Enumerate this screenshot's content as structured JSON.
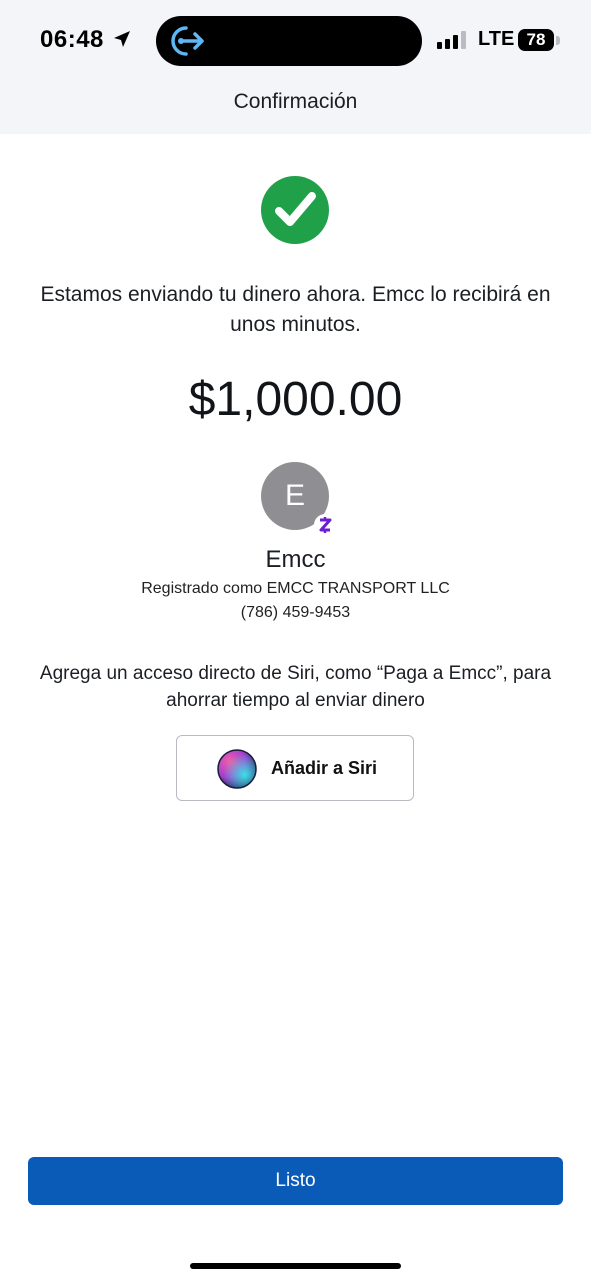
{
  "status_bar": {
    "time": "06:48",
    "network": "LTE",
    "battery": "78",
    "icons": [
      "location-arrow-icon",
      "session-share-icon",
      "signal-icon",
      "battery-icon"
    ]
  },
  "header": {
    "title": "Confirmación"
  },
  "confirmation": {
    "icon": "checkmark-icon",
    "message": "Estamos enviando tu dinero ahora. Emcc lo recibirá en unos minutos.",
    "amount": "$1,000.00"
  },
  "recipient": {
    "initial": "E",
    "name": "Emcc",
    "registered_as": "Registrado como EMCC TRANSPORT LLC",
    "phone": "(786) 459-9453",
    "badge_icon": "zelle-icon"
  },
  "siri": {
    "hint": "Agrega un acceso directo de Siri, como “Paga a Emcc”, para ahorrar tiempo al enviar dinero",
    "button_label": "Añadir a Siri",
    "icon": "siri-icon"
  },
  "footer": {
    "done_label": "Listo"
  },
  "colors": {
    "success": "#21a04a",
    "primary": "#0a5bb8",
    "zelle": "#6d1ed4",
    "avatar": "#8e8e93"
  }
}
